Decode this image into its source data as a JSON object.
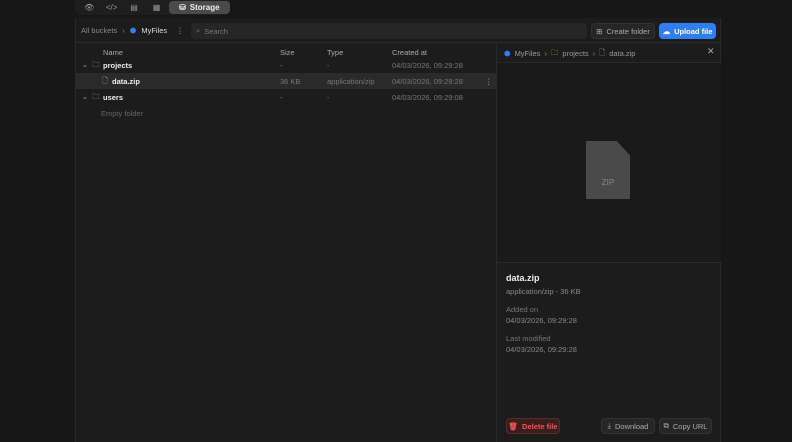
{
  "tabs": {
    "preview": "eye-icon",
    "code": "code-icon",
    "database": "database-icon",
    "table": "table-icon",
    "storage": "Storage"
  },
  "toolbar": {
    "all_buckets": "All buckets",
    "bucket": "MyFiles",
    "search_placeholder": "Search",
    "create_folder": "Create folder",
    "upload_file": "Upload file"
  },
  "columns": {
    "name": "Name",
    "size": "Size",
    "type": "Type",
    "created": "Created at"
  },
  "rows": [
    {
      "name": "projects",
      "size": "-",
      "type": "-",
      "created": "04/03/2026, 09:29:28"
    },
    {
      "name": "data.zip",
      "size": "36 KB",
      "type": "application/zip",
      "created": "04/03/2026, 09:29:28"
    },
    {
      "name": "users",
      "size": "-",
      "type": "-",
      "created": "04/03/2026, 09:29:08"
    }
  ],
  "empty_folder": "Empty folder",
  "preview": {
    "crumb": [
      "MyFiles",
      "projects",
      "data.zip"
    ],
    "thumb_label": "ZIP",
    "file_name": "data.zip",
    "meta": "application/zip - 36 KB",
    "added_label": "Added on",
    "added": "04/03/2026, 09:29:28",
    "modified_label": "Last modified",
    "modified": "04/03/2026, 09:29:28",
    "delete": "Delete file",
    "download": "Download",
    "copy_url": "Copy URL"
  },
  "colors": {
    "accent": "#2f7ff0",
    "danger": "#e55555",
    "folder": "#c8902a"
  }
}
